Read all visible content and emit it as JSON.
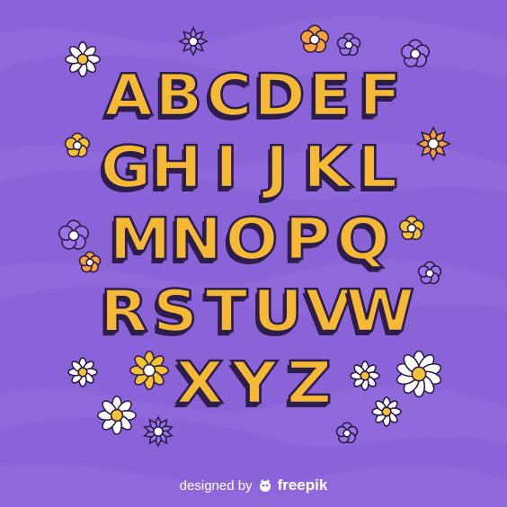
{
  "colors": {
    "background": "#8a63d8",
    "wave": "#9470e0",
    "letter_fill": "#f6b936",
    "letter_shade": "#ee9a2b",
    "outline": "#2c1d4a",
    "flower_white": "#ffffff",
    "flower_orange": "#f7a23a",
    "flower_purple": "#9b74e6",
    "flower_center": "#f5c236"
  },
  "alphabet_rows": [
    [
      "A",
      "B",
      "C",
      "D",
      "E",
      "F"
    ],
    [
      "G",
      "H",
      "I",
      "J",
      "K",
      "L"
    ],
    [
      "M",
      "N",
      "O",
      "P",
      "Q"
    ],
    [
      "R",
      "S",
      "T",
      "U",
      "V",
      "W"
    ],
    [
      "X",
      "Y",
      "Z"
    ]
  ],
  "flowers": [
    {
      "kind": "daisy-white",
      "petals": 8
    },
    {
      "kind": "star-purple",
      "petals": 8
    },
    {
      "kind": "round-orange",
      "petals": 5
    },
    {
      "kind": "round-purple",
      "petals": 5
    },
    {
      "kind": "round-purple",
      "petals": 5
    },
    {
      "kind": "round-yellow",
      "petals": 5
    },
    {
      "kind": "star-orange",
      "petals": 8
    },
    {
      "kind": "round-purple",
      "petals": 5
    },
    {
      "kind": "round-yellow",
      "petals": 5
    },
    {
      "kind": "round-orange",
      "petals": 5
    },
    {
      "kind": "round-purple",
      "petals": 5
    },
    {
      "kind": "daisy-white",
      "petals": 8
    },
    {
      "kind": "daisy-yellow",
      "petals": 8
    },
    {
      "kind": "daisy-white",
      "petals": 8
    },
    {
      "kind": "daisy-white",
      "petals": 10
    },
    {
      "kind": "daisy-white",
      "petals": 8
    },
    {
      "kind": "star-purple",
      "petals": 10
    },
    {
      "kind": "daisy-white",
      "petals": 8
    },
    {
      "kind": "round-purple",
      "petals": 5
    }
  ],
  "credit": {
    "prefix": "designed by",
    "brand": "freepik",
    "logo_icon": "freepik-logo-icon"
  }
}
